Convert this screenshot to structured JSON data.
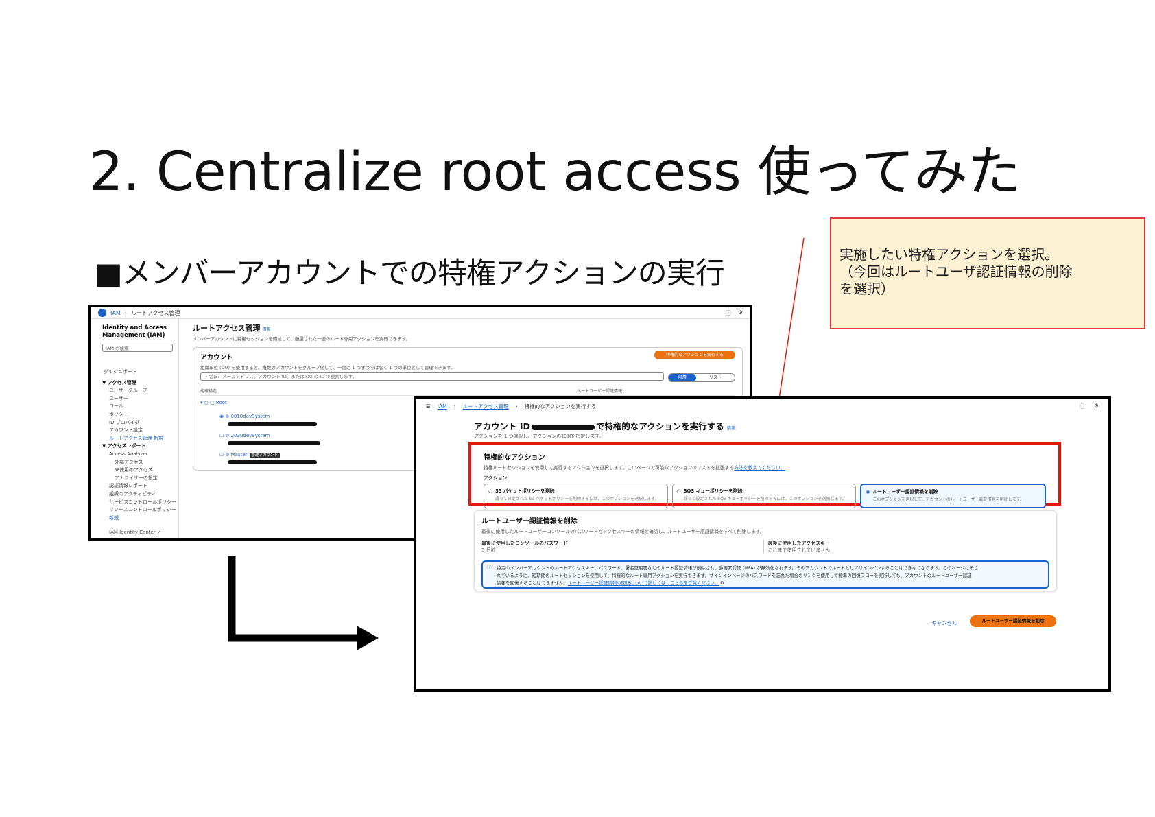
{
  "slide": {
    "title": "2. Centralize root access 使ってみた",
    "subtitle": "■メンバーアカウントでの特権アクションの実行"
  },
  "callout": {
    "line1": "実施したい特権アクションを選択。",
    "line2": "（今回はルートユーザ認証情報の削除",
    "line3": "を選択）",
    "border_color": "#e03a3a",
    "background": "#fdf1d3"
  },
  "iam_list": {
    "breadcrumb_service": "IAM",
    "breadcrumb_page": "ルートアクセス管理",
    "sidebar": {
      "brand": "Identity and Access Management (IAM)",
      "search_placeholder": "IAM の検索",
      "items": [
        {
          "label": "ダッシュボード"
        },
        {
          "label": "▼ アクセス管理"
        },
        {
          "label": "ユーザーグループ"
        },
        {
          "label": "ユーザー"
        },
        {
          "label": "ロール"
        },
        {
          "label": "ポリシー"
        },
        {
          "label": "ID プロバイダ"
        },
        {
          "label": "アカウント設定"
        },
        {
          "label": "ルートアクセス管理",
          "badge": "新規"
        },
        {
          "label": "▼ アクセスレポート"
        },
        {
          "label": "Access Analyzer"
        },
        {
          "label": "外部アクセス"
        },
        {
          "label": "未使用のアクセス"
        },
        {
          "label": "アナライザーの設定"
        },
        {
          "label": "認証情報レポート"
        },
        {
          "label": "組織のアクティビティ"
        },
        {
          "label": "サービスコントロールポリシー"
        },
        {
          "label": "リソースコントロールポリシー"
        },
        {
          "label": "新規"
        },
        {
          "label": "IAM Identity Center ↗"
        }
      ]
    },
    "page_title": "ルートアクセス管理",
    "info_link": "情報",
    "page_desc": "メンバーアカウントに特権セッションを開始して、厳選された一連のルート専用アクションを実行できます。",
    "panel_title": "アカウント",
    "panel_desc": "組織単位 (OU) を使用すると、複数のアカウントをグループ化して、一度に 1 つずつではなく 1 つの単位として管理できます。",
    "primary_button": "特権的なアクションを実行する",
    "search_placeholder": "名前、メールアドレス、アカウント ID、または OU の ID で検索します。",
    "toggle_on": "階層",
    "toggle_off": "リスト",
    "col_structure": "組織構造",
    "col_credentials": "ルートユーザー認証情報",
    "root_label": "Root",
    "accounts": [
      {
        "name": "0010devSystem"
      },
      {
        "name": "2030devSystem"
      },
      {
        "name": "Master",
        "tag": "管理アカウント"
      }
    ]
  },
  "action_page": {
    "breadcrumb_service": "IAM",
    "breadcrumb_parent": "ルートアクセス管理",
    "breadcrumb_current": "特権的なアクションを実行する",
    "title_prefix": "アカウント ID",
    "title_suffix": "で特権的なアクションを実行する",
    "info_link": "情報",
    "desc": "アクションを 1 つ選択し、アクションの詳細を指定します。",
    "actions_title": "特権的なアクション",
    "actions_desc": "特権ルートセッションを使用して実行するアクションを選択します。このページで可能なアクションのリストを拡張する",
    "actions_link": "方法を教えてください。",
    "actions_label": "アクション",
    "options": [
      {
        "title": "S3 バケットポリシーを削除",
        "desc": "誤って設定された S3 バケットポリシーを削除するには、このオプションを選択します。",
        "selected": false
      },
      {
        "title": "SQS キューポリシーを削除",
        "desc": "誤って設定された SQS キューポリシーを削除するには、このオプションを選択します。",
        "selected": false
      },
      {
        "title": "ルートユーザー認証情報を削除",
        "desc": "このオプションを選択して、アカウントのルートユーザー認証情報を削除します。",
        "selected": true
      }
    ],
    "delete_title": "ルートユーザー認証情報を削除",
    "delete_desc": "最後に使用したルートユーザーコンソールのパスワードとアクセスキーの情報を確認し、ルートユーザー認証情報をすべて削除します。",
    "last_password_label": "最後に使用したコンソールのパスワード",
    "last_password_value": "5 日前",
    "last_key_label": "最後に使用したアクセスキー",
    "last_key_value": "これまで使用されていません",
    "alert_line1": "特定のメンバーアカウントのルートアクセスキー、パスワード、署名証明書などのルート認証情報が削除され、多要素認証 (MFA) が無効化されます。そのアカウントでルートとしてサインインすることはできなくなります。このページに示さ",
    "alert_line2": "れているように、短期間のルートセッションを使用して、特権的なルート専用アクションを実行できます。サインインページのパスワードを忘れた場合のリンクを使用して標準の回復フローを実行しても、アカウントのルートユーザー認証",
    "alert_line3": "情報を回復することはできません。",
    "alert_link": "ルートユーザー認証情報の回復について詳しくは、こちらをご覧ください。",
    "cancel": "キャンセル",
    "submit": "ルートユーザー認証情報を削除",
    "highlight_color": "#e3170a"
  }
}
